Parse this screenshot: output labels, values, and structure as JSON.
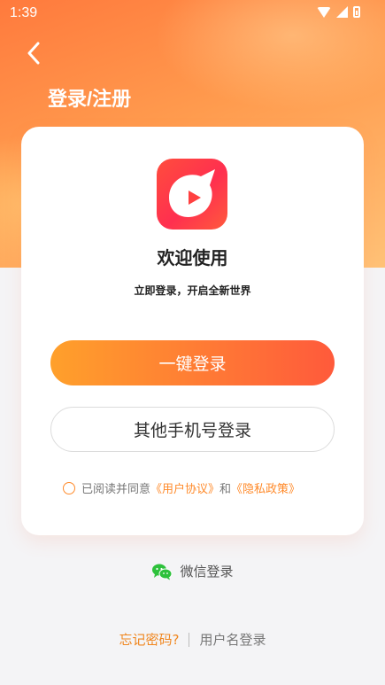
{
  "status_bar": {
    "time": "1:39"
  },
  "header": {
    "title": "登录/注册"
  },
  "card": {
    "welcome": "欢迎使用",
    "subtitle": "立即登录，开启全新世界",
    "primary_button": "一键登录",
    "secondary_button": "其他手机号登录",
    "agreement": {
      "prefix": "已阅读并同意",
      "user_agreement": "《用户协议》",
      "conjunction": "和",
      "privacy_policy": "《隐私政策》"
    }
  },
  "wechat_login": "微信登录",
  "footer": {
    "forgot_password": "忘记密码?",
    "username_login": "用户名登录"
  },
  "colors": {
    "accent": "#ff8a2a",
    "primary_start": "#ffa02b",
    "primary_end": "#ff5a3b",
    "logo": "#ff3b4a",
    "wechat": "#2dc13b"
  },
  "icons": [
    "wifi-icon",
    "cellular-icon",
    "battery-icon",
    "back-arrow-icon",
    "app-logo-icon",
    "radio-unchecked-icon",
    "wechat-icon"
  ]
}
